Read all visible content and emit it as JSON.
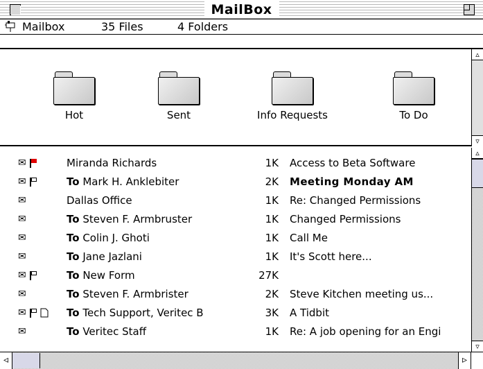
{
  "window": {
    "title": "MailBox"
  },
  "info": {
    "icon": "mailbox-icon",
    "mailbox_label": "Mailbox",
    "files": "35 Files",
    "folders": "4 Folders"
  },
  "folders": [
    {
      "label": "Hot"
    },
    {
      "label": "Sent"
    },
    {
      "label": "Info Requests"
    },
    {
      "label": "To Do"
    }
  ],
  "messages": [
    {
      "env": "✉",
      "flag": "red",
      "doc": "",
      "to": "",
      "name": "Miranda Richards",
      "size": "1K",
      "subject": "Access to Beta Software",
      "bold": false
    },
    {
      "env": "✉",
      "flag": "outline",
      "doc": "",
      "to": "To",
      "name": "Mark H. Anklebiter",
      "size": "2K",
      "subject": "Meeting Monday AM",
      "bold": true
    },
    {
      "env": "✉",
      "flag": "",
      "doc": "",
      "to": "",
      "name": "Dallas Office",
      "size": "1K",
      "subject": "Re: Changed Permissions",
      "bold": false
    },
    {
      "env": "✉",
      "flag": "",
      "doc": "",
      "to": "To",
      "name": "Steven F. Armbruster",
      "size": "1K",
      "subject": "Changed Permissions",
      "bold": false
    },
    {
      "env": "✉",
      "flag": "",
      "doc": "",
      "to": "To",
      "name": "Colin J. Ghoti",
      "size": "1K",
      "subject": "Call Me",
      "bold": false
    },
    {
      "env": "✉",
      "flag": "",
      "doc": "",
      "to": "To",
      "name": "Jane Jazlani",
      "size": "1K",
      "subject": "It's Scott here...",
      "bold": false
    },
    {
      "env": "✉",
      "flag": "outline",
      "doc": "",
      "to": "To",
      "name": "New Form",
      "size": "27K",
      "subject": "",
      "bold": false
    },
    {
      "env": "✉",
      "flag": "",
      "doc": "",
      "to": "To",
      "name": "Steven F. Armbrister",
      "size": "2K",
      "subject": "Steve Kitchen meeting us...",
      "bold": false
    },
    {
      "env": "✉",
      "flag": "outline",
      "doc": "doc",
      "to": "To",
      "name": "Tech Support, Veritec B",
      "size": "3K",
      "subject": "A Tidbit",
      "bold": false
    },
    {
      "env": "✉",
      "flag": "",
      "doc": "",
      "to": "To",
      "name": "Veritec Staff",
      "size": "1K",
      "subject": "Re: A job opening for an Engi",
      "bold": false
    }
  ]
}
